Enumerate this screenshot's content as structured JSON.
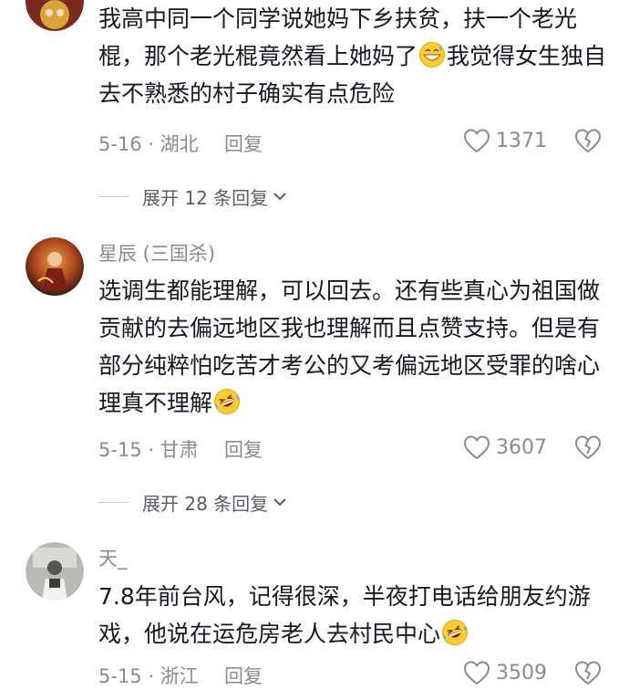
{
  "comments": [
    {
      "username": "",
      "text_parts": [
        "我高中同一个同学说她妈下乡扶贫，扶一个老光棍，那个老光棍竟然看上她妈了",
        "我觉得女生独自去不熟悉的村子确实有点危险"
      ],
      "emoji": "grin-sweat-emoji",
      "date_location": "5-16 · 湖北",
      "reply_label": "回复",
      "likes": "1371",
      "expand_label": "展开 12 条回复"
    },
    {
      "username": "星辰 (三国杀)",
      "text_parts": [
        "选调生都能理解，可以回去。还有些真心为祖国做贡献的去偏远地区我也理解而且点赞支持。但是有部分纯粹怕吃苦才考公的又考偏远地区受罪的啥心理真不理解",
        ""
      ],
      "emoji": "rolling-laugh-emoji",
      "date_location": "5-15 · 甘肃",
      "reply_label": "回复",
      "likes": "3607",
      "expand_label": "展开 28 条回复"
    },
    {
      "username": "天_",
      "text_parts": [
        "7.8年前台风，记得很深，半夜打电话给朋友约游戏，他说在运危房老人去村民中心",
        ""
      ],
      "emoji": "rolling-laugh-emoji",
      "date_location": "5-15 · 浙江",
      "reply_label": "回复",
      "likes": "3509"
    }
  ],
  "colors": {
    "text": "#161823",
    "muted": "#8a8b91",
    "divider": "#c9c9cd"
  }
}
